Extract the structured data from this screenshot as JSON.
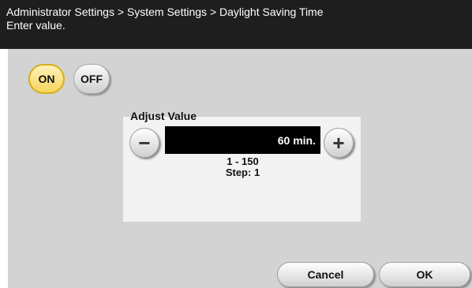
{
  "header": {
    "breadcrumb": "Administrator Settings > System Settings > Daylight Saving Time",
    "prompt": "Enter value."
  },
  "toggle": {
    "on_label": "ON",
    "off_label": "OFF",
    "selected": "ON"
  },
  "adjust": {
    "title": "Adjust Value",
    "value": "60 min.",
    "minus_symbol": "−",
    "plus_symbol": "+",
    "range": "1 - 150",
    "step": "Step: 1"
  },
  "footer": {
    "cancel_label": "Cancel",
    "ok_label": "OK"
  },
  "colors": {
    "header_bg": "#1e1e1e",
    "panel_bg": "#d3d3d3",
    "selected_toggle": "#f5d55c",
    "value_field_bg": "#000000"
  }
}
